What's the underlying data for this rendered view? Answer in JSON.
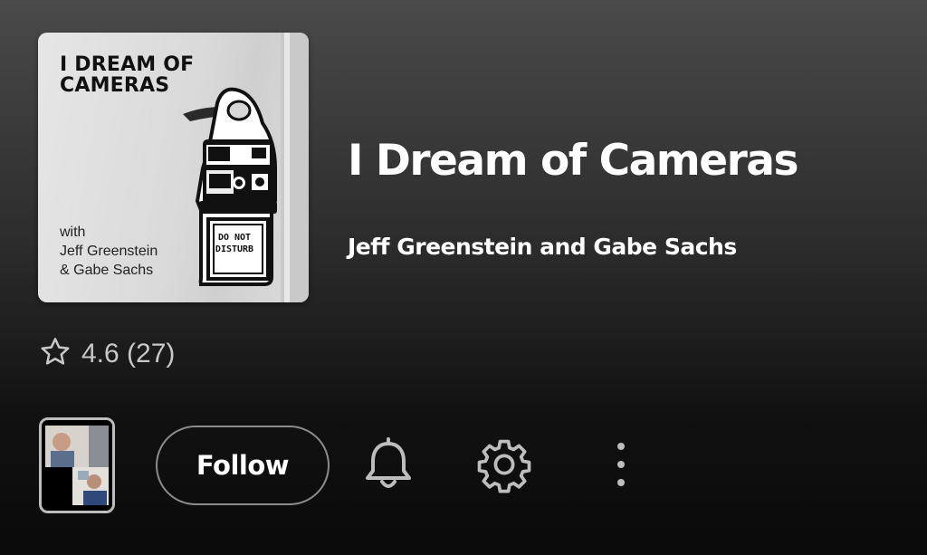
{
  "cover": {
    "title": "I DREAM OF\nCAMERAS",
    "credit": "with\nJeff Greenstein\n& Gabe Sachs",
    "hanger_text": "DO NOT\nDISTURB"
  },
  "podcast": {
    "title": "I Dream of Cameras",
    "author": "Jeff Greenstein and Gabe Sachs"
  },
  "rating": {
    "text": "4.6 (27)",
    "icon": "star-outline-icon"
  },
  "actions": {
    "follow_label": "Follow",
    "notification_icon": "bell-icon",
    "settings_icon": "gear-icon",
    "more_icon": "more-vertical-icon"
  },
  "colors": {
    "background_top": "#4a4a4a",
    "background_bottom": "#0a0a0a",
    "text_primary": "#ffffff",
    "text_secondary": "#c8c8c8",
    "button_border": "#8c8c8c"
  }
}
